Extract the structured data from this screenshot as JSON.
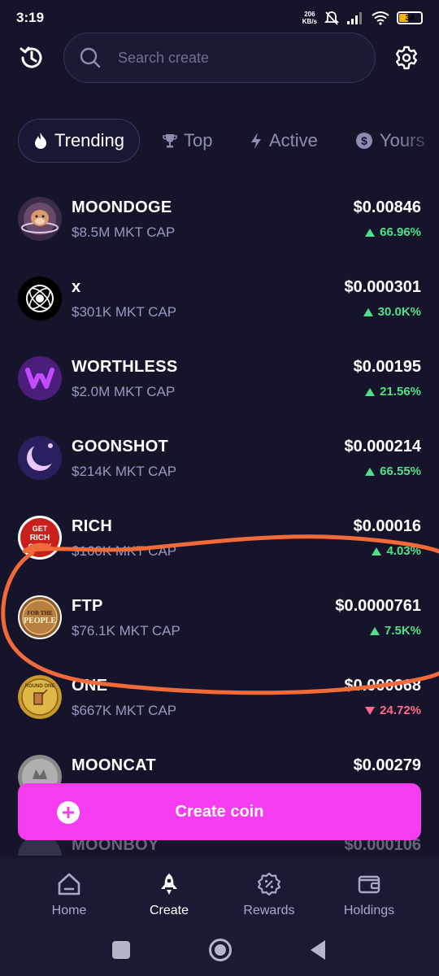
{
  "status_bar": {
    "time": "3:19",
    "net_speed_value": "206",
    "net_speed_unit": "KB/s",
    "battery": "34"
  },
  "header": {
    "search_placeholder": "Search create"
  },
  "tabs": [
    {
      "label": "Trending",
      "icon": "flame-icon",
      "active": true
    },
    {
      "label": "Top",
      "icon": "trophy-icon",
      "active": false
    },
    {
      "label": "Active",
      "icon": "lightning-icon",
      "active": false
    },
    {
      "label": "Yours",
      "icon": "coin-icon",
      "active": false
    }
  ],
  "coins": [
    {
      "name": "MOONDOGE",
      "cap": "$8.5M MKT CAP",
      "price": "$0.00846",
      "change": "66.96%",
      "direction": "up"
    },
    {
      "name": "x",
      "cap": "$301K MKT CAP",
      "price": "$0.000301",
      "change": "30.0K%",
      "direction": "up"
    },
    {
      "name": "WORTHLESS",
      "cap": "$2.0M MKT CAP",
      "price": "$0.00195",
      "change": "21.56%",
      "direction": "up"
    },
    {
      "name": "GOONSHOT",
      "cap": "$214K MKT CAP",
      "price": "$0.000214",
      "change": "66.55%",
      "direction": "up"
    },
    {
      "name": "RICH",
      "cap": "$160K MKT CAP",
      "price": "$0.00016",
      "change": "4.03%",
      "direction": "up",
      "avatar_text": [
        "GET",
        "RICH",
        "QUICK"
      ]
    },
    {
      "name": "FTP",
      "cap": "$76.1K MKT CAP",
      "price": "$0.0000761",
      "change": "7.5K%",
      "direction": "up",
      "avatar_text": [
        "FOR THE",
        "PEOPLE"
      ]
    },
    {
      "name": "ONE",
      "cap": "$667K MKT CAP",
      "price": "$0.000668",
      "change": "24.72%",
      "direction": "down",
      "avatar_text": [
        "ROUND ONE"
      ]
    },
    {
      "name": "MOONCAT",
      "cap": "",
      "price": "$0.00279",
      "change": "",
      "direction": "up"
    },
    {
      "name": "MOONBOY",
      "cap": "",
      "price": "$0.000106",
      "change": "",
      "direction": "up"
    }
  ],
  "create_button": {
    "label": "Create coin"
  },
  "bottom_nav": [
    {
      "label": "Home",
      "icon": "home-icon",
      "active": false
    },
    {
      "label": "Create",
      "icon": "rocket-icon",
      "active": true
    },
    {
      "label": "Rewards",
      "icon": "rewards-badge-icon",
      "active": false
    },
    {
      "label": "Holdings",
      "icon": "wallet-icon",
      "active": false
    }
  ],
  "colors": {
    "background": "#15142b",
    "accent": "#f53cf0",
    "positive": "#4fe08a",
    "negative": "#ff6b8a",
    "annotation": "#f06a3a"
  }
}
